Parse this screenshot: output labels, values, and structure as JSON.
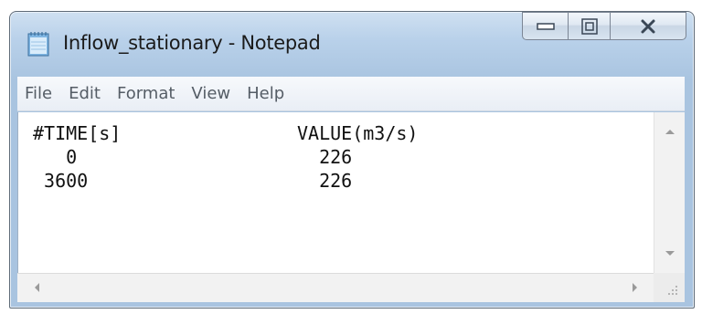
{
  "window": {
    "title": "Inflow_stationary - Notepad"
  },
  "icons": {
    "app": "notepad-icon",
    "minimize": "minimize-icon",
    "maximize": "maximize-icon",
    "close": "close-icon"
  },
  "menu": {
    "items": [
      "File",
      "Edit",
      "Format",
      "View",
      "Help"
    ]
  },
  "document": {
    "text": "#TIME[s]                VALUE(m3/s)\n   0                      226\n 3600                     226"
  },
  "colors": {
    "title_bar": "#b9d1ea",
    "close_glyph": "#3a4756"
  }
}
